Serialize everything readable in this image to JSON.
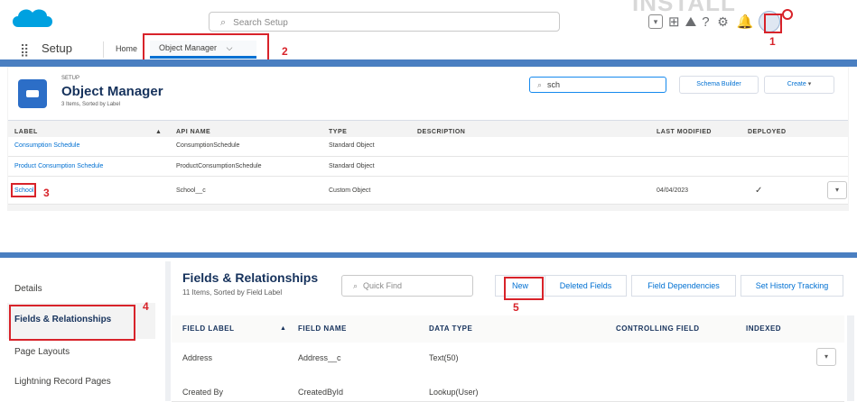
{
  "header": {
    "search_placeholder": "Search Setup",
    "help_glyph": "?",
    "watermark": "INSTALL"
  },
  "nav": {
    "app_name": "Setup",
    "tabs": [
      {
        "label": "Home"
      },
      {
        "label": "Object Manager",
        "chevron": "⌵"
      }
    ]
  },
  "object_manager": {
    "setup_label": "SETUP",
    "title": "Object Manager",
    "subtitle": "3 Items, Sorted by Label",
    "search_value": "sch",
    "buttons": {
      "schema_builder": "Schema Builder",
      "create": "Create"
    },
    "columns": [
      "LABEL",
      "API NAME",
      "TYPE",
      "DESCRIPTION",
      "LAST MODIFIED",
      "DEPLOYED"
    ],
    "rows": [
      {
        "label": "Consumption Schedule",
        "api": "ConsumptionSchedule",
        "type": "Standard Object",
        "modified": "",
        "deployed": ""
      },
      {
        "label": "Product Consumption Schedule",
        "api": "ProductConsumptionSchedule",
        "type": "Standard Object",
        "modified": "",
        "deployed": ""
      },
      {
        "label": "School",
        "api": "School__c",
        "type": "Custom Object",
        "modified": "04/04/2023",
        "deployed": "✓"
      }
    ]
  },
  "left_nav": {
    "items": [
      {
        "label": "Details"
      },
      {
        "label": "Fields & Relationships"
      },
      {
        "label": "Page Layouts"
      },
      {
        "label": "Lightning Record Pages"
      }
    ]
  },
  "fields": {
    "title": "Fields & Relationships",
    "subtitle": "11 Items, Sorted by Field Label",
    "quick_find_placeholder": "Quick Find",
    "buttons": {
      "new": "New",
      "deleted": "Deleted Fields",
      "dependencies": "Field Dependencies",
      "history": "Set History Tracking"
    },
    "columns": [
      "FIELD LABEL",
      "FIELD NAME",
      "DATA TYPE",
      "CONTROLLING FIELD",
      "INDEXED"
    ],
    "sort_glyph": "▲",
    "rows": [
      {
        "label": "Address",
        "name": "Address__c",
        "type": "Text(50)"
      },
      {
        "label": "Created By",
        "name": "CreatedById",
        "type": "Lookup(User)"
      }
    ]
  },
  "annotations": {
    "n1": "1",
    "n2": "2",
    "n3": "3",
    "n4": "4",
    "n5": "5"
  },
  "colors": {
    "accent": "#0070d2",
    "brand": "#00a1e0",
    "annotation": "#d8232a",
    "band": "#4a7fc1"
  }
}
